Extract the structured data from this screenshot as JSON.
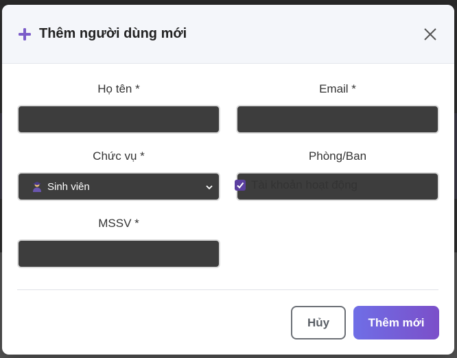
{
  "modal": {
    "title": "Thêm người dùng mới",
    "close_icon": "close-icon",
    "title_icon": "plus-icon"
  },
  "form": {
    "full_name": {
      "label": "Họ tên *",
      "value": ""
    },
    "email": {
      "label": "Email *",
      "value": ""
    },
    "position": {
      "label": "Chức vụ *",
      "selected": "Sinh viên",
      "icon": "student-icon"
    },
    "department": {
      "label": "Phòng/Ban",
      "value": ""
    },
    "student_id": {
      "label": "MSSV *",
      "value": ""
    },
    "active_account": {
      "label": "Tài khoản hoạt động",
      "checked": true
    }
  },
  "buttons": {
    "cancel": "Hủy",
    "submit": "Thêm mới"
  },
  "colors": {
    "accent": "#7b4fc9",
    "input_bg": "#3d3d3d",
    "header_bg": "#f4f6fa"
  }
}
